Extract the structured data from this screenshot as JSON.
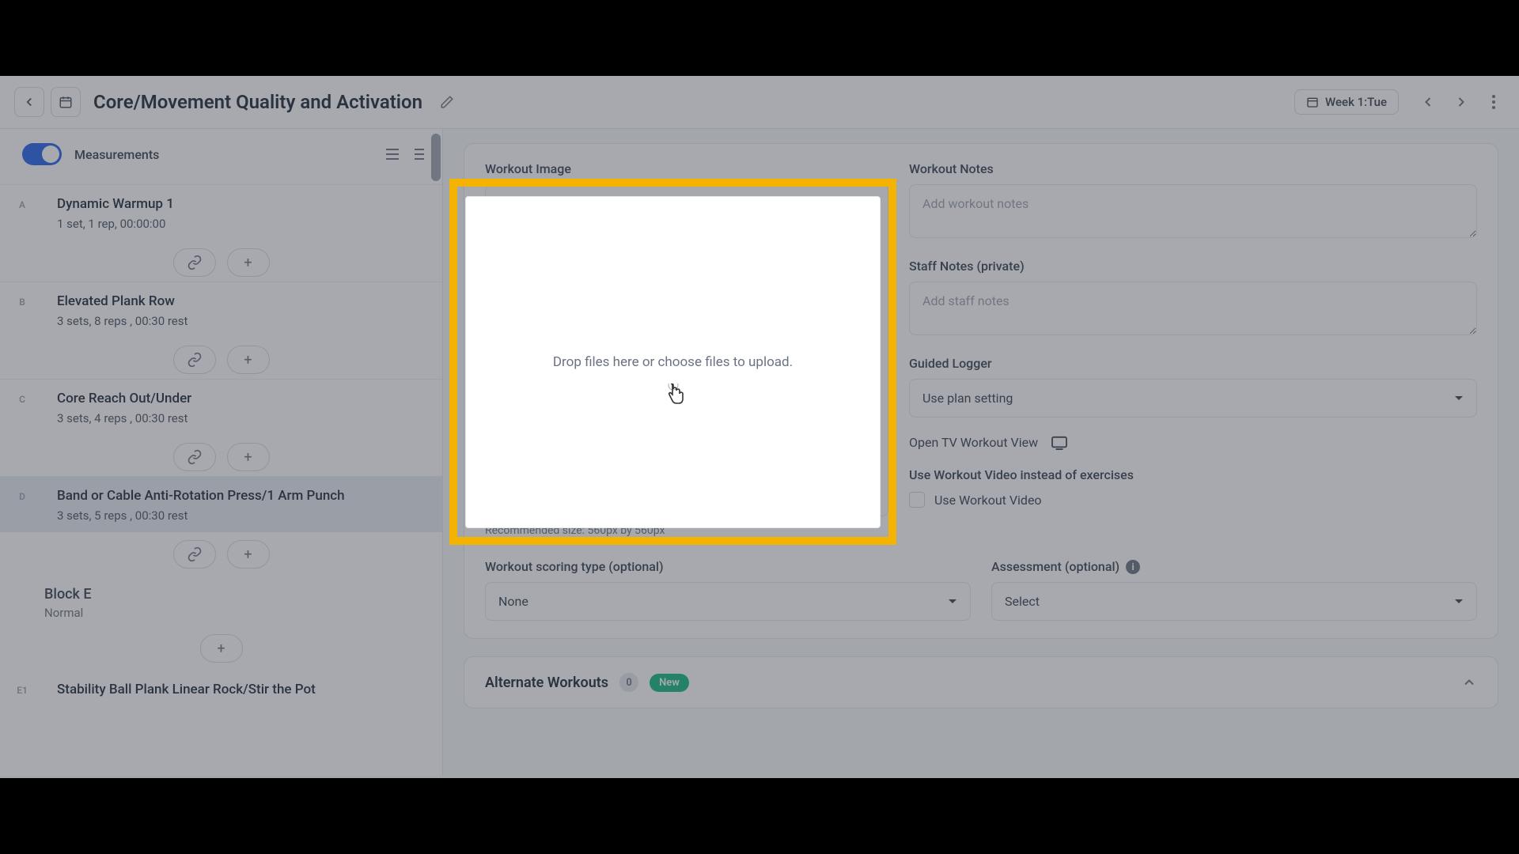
{
  "header": {
    "title": "Core/Movement Quality and Activation",
    "week_label": "Week 1:Tue"
  },
  "sidebar": {
    "measurements_label": "Measurements",
    "exercises": [
      {
        "letter": "A",
        "name": "Dynamic Warmup 1",
        "detail": "1 set, 1 rep, 00:00:00"
      },
      {
        "letter": "B",
        "name": "Elevated Plank Row",
        "detail": "3 sets, 8 reps , 00:30 rest"
      },
      {
        "letter": "C",
        "name": "Core Reach Out/Under",
        "detail": "3 sets, 4 reps , 00:30 rest"
      },
      {
        "letter": "D",
        "name": "Band or Cable Anti-Rotation Press/1 Arm Punch",
        "detail": "3 sets, 5 reps , 00:30 rest"
      }
    ],
    "block_title": "Block E",
    "block_sub": "Normal",
    "last_ex_letter": "E1",
    "last_ex_name": "Stability Ball Plank Linear Rock/Stir the Pot"
  },
  "main": {
    "workout_image_label": "Workout Image",
    "dropzone_text": "Drop files here or choose files to upload.",
    "dropzone_hint": "Recommended size: 560px by 560px",
    "workout_notes_label": "Workout Notes",
    "workout_notes_placeholder": "Add workout notes",
    "staff_notes_label": "Staff Notes (private)",
    "staff_notes_placeholder": "Add staff notes",
    "guided_logger_label": "Guided Logger",
    "guided_logger_value": "Use plan setting",
    "open_tv_label": "Open TV Workout View",
    "use_video_heading": "Use Workout Video instead of exercises",
    "use_video_checkbox": "Use Workout Video",
    "scoring_label": "Workout scoring type (optional)",
    "scoring_value": "None",
    "assessment_label": "Assessment (optional)",
    "assessment_value": "Select",
    "alt_title": "Alternate Workouts",
    "alt_count": "0",
    "alt_new": "New"
  },
  "overlay": {
    "dropzone_text": "Drop files here or choose files to upload."
  }
}
